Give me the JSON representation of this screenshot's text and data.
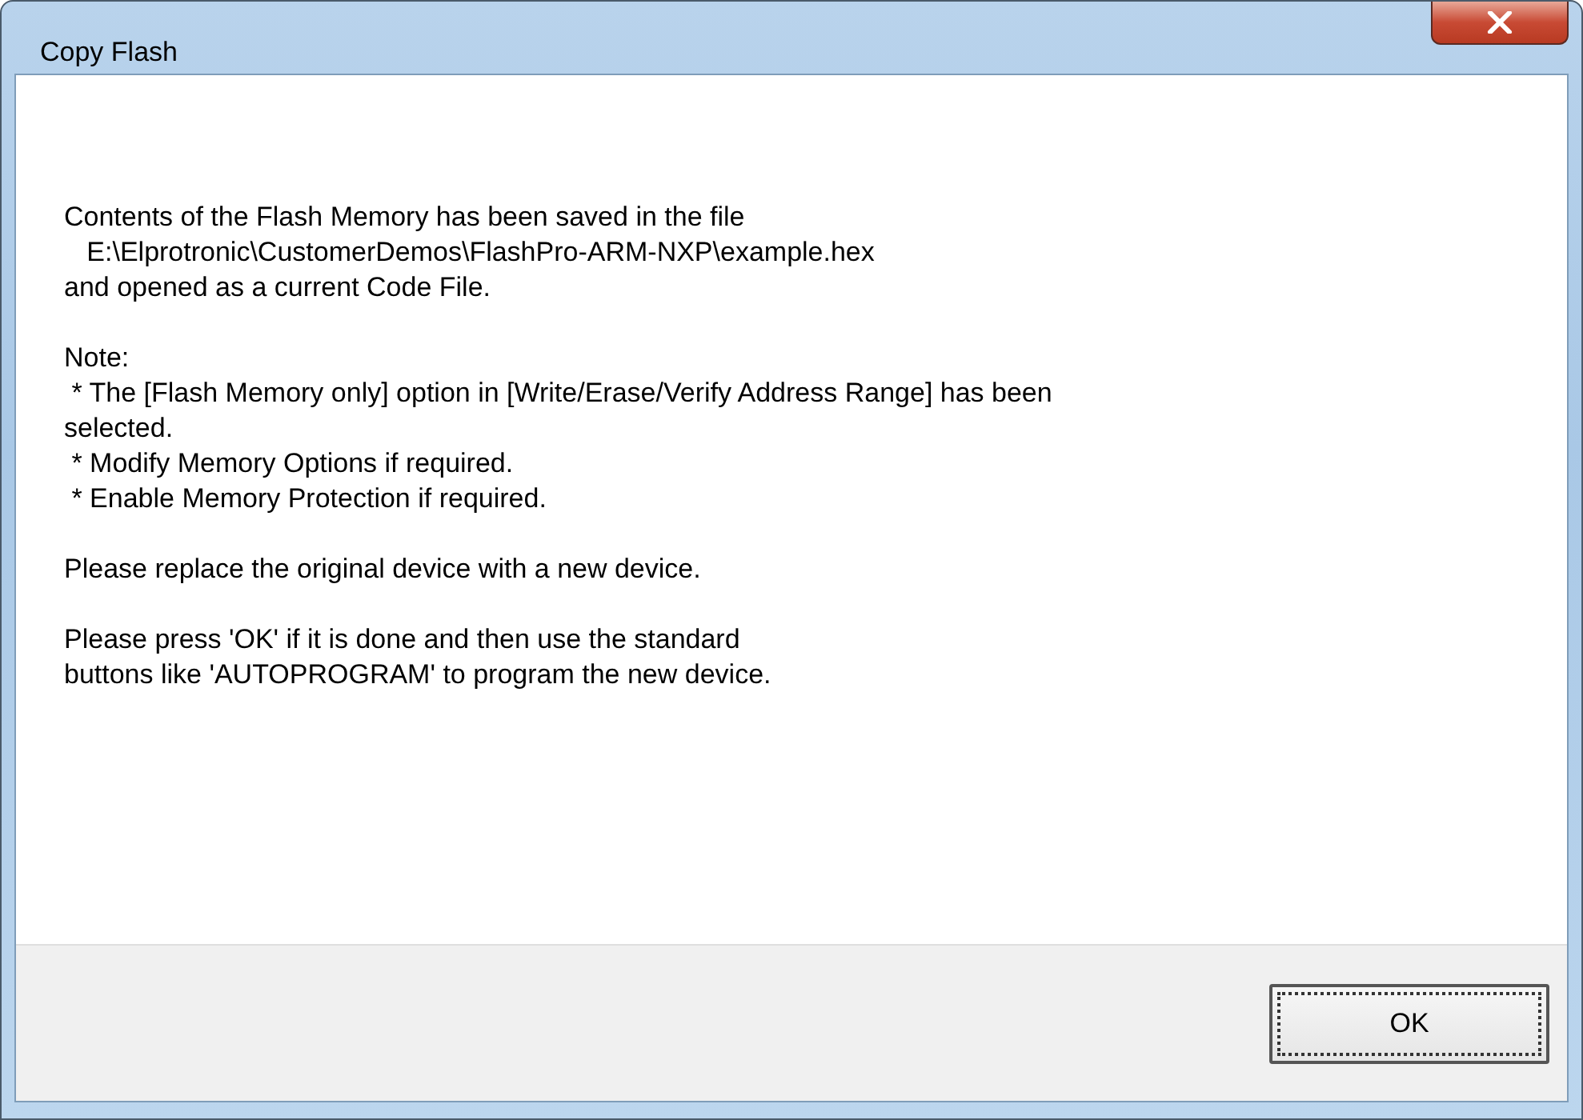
{
  "window": {
    "title": "Copy Flash"
  },
  "message": [
    [
      "Contents of the Flash Memory has been saved in the file",
      "   E:\\Elprotronic\\CustomerDemos\\FlashPro-ARM-NXP\\example.hex",
      "and opened as a current Code File."
    ],
    [
      "Note:",
      " * The [Flash Memory only] option in [Write/Erase/Verify Address Range] has been",
      "selected.",
      " * Modify Memory Options if required.",
      " * Enable Memory Protection if required."
    ],
    [
      "Please replace the original device with a new device."
    ],
    [
      "Please press 'OK' if it is done and then use the standard",
      "buttons like 'AUTOPROGRAM' to program the new device."
    ]
  ],
  "buttons": [
    {
      "label": "OK",
      "selected": true
    }
  ]
}
